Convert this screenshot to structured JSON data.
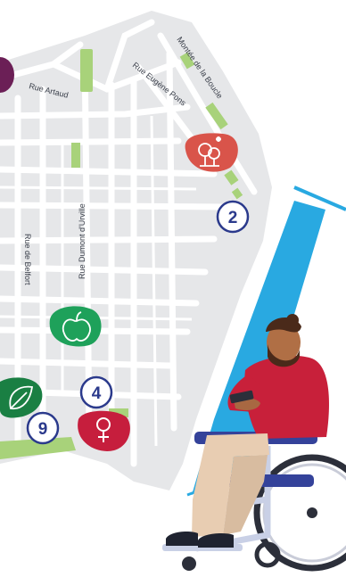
{
  "map": {
    "streets": {
      "rue_artaud": "Rue Artaud",
      "rue_eugene_pons": "Rue Eugène Pons",
      "montee_de_la_boucle": "Montée de la Boucle",
      "rue_dumont_durville": "Rue Dumont d'Urville",
      "rue_de_belfort": "Rue de Belfort"
    },
    "markers": [
      {
        "icon": "park-tree-icon",
        "color": "#d9544a"
      },
      {
        "icon": "apple-icon",
        "color": "#1ea15a"
      },
      {
        "icon": "female-symbol-icon",
        "color": "#c61e3d"
      },
      {
        "icon": "leaf-icon",
        "color": "#1a7f43"
      },
      {
        "icon": "partial-marker",
        "color": "#6b1f56"
      }
    ],
    "numbers": {
      "n2": "2",
      "n4": "4",
      "n9": "9"
    },
    "colors": {
      "land": "#e6e7e9",
      "road": "#ffffff",
      "river": "#29a9e1",
      "park": "#a8d27a",
      "badge_ring": "#2b3a8c"
    }
  },
  "illustration": {
    "subject": "person-in-wheelchair-with-phone"
  }
}
